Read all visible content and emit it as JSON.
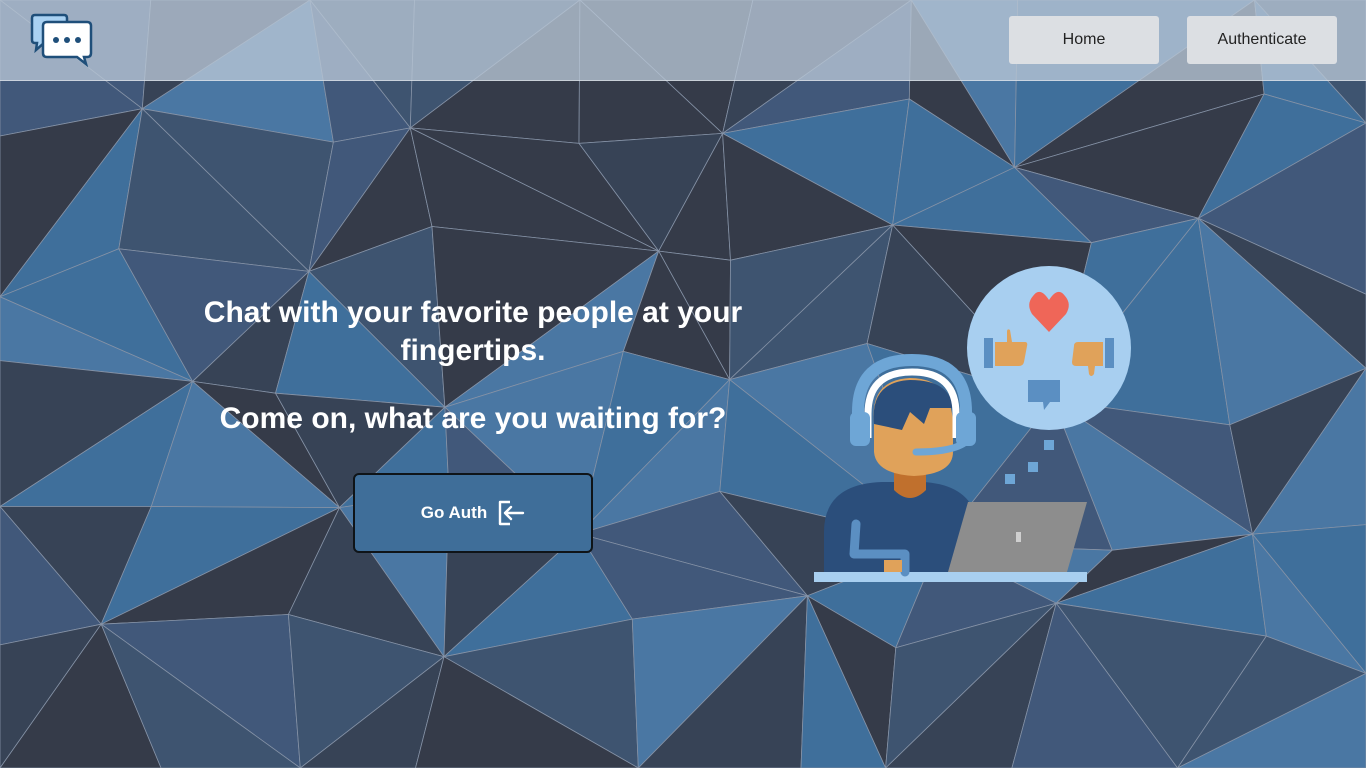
{
  "header": {
    "nav": {
      "home_label": "Home",
      "authenticate_label": "Authenticate"
    }
  },
  "hero": {
    "title": "Chat with your favorite people at your fingertips.",
    "subtitle": "Come on, what are you waiting for?",
    "cta_label": "Go Auth"
  },
  "icons": {
    "logo": "chat-bubbles-icon",
    "cta": "login-arrow-icon",
    "illustration": "support-agent-illustration"
  },
  "colors": {
    "navbar_bg": "#b9c6d6",
    "nav_button_bg": "#dcdfe3",
    "cta_bg": "#3f6e99",
    "hero_text": "#ffffff",
    "bg_dark": "#353b49",
    "bg_mid": "#3e5470",
    "bg_blue": "#3f6f9b"
  }
}
